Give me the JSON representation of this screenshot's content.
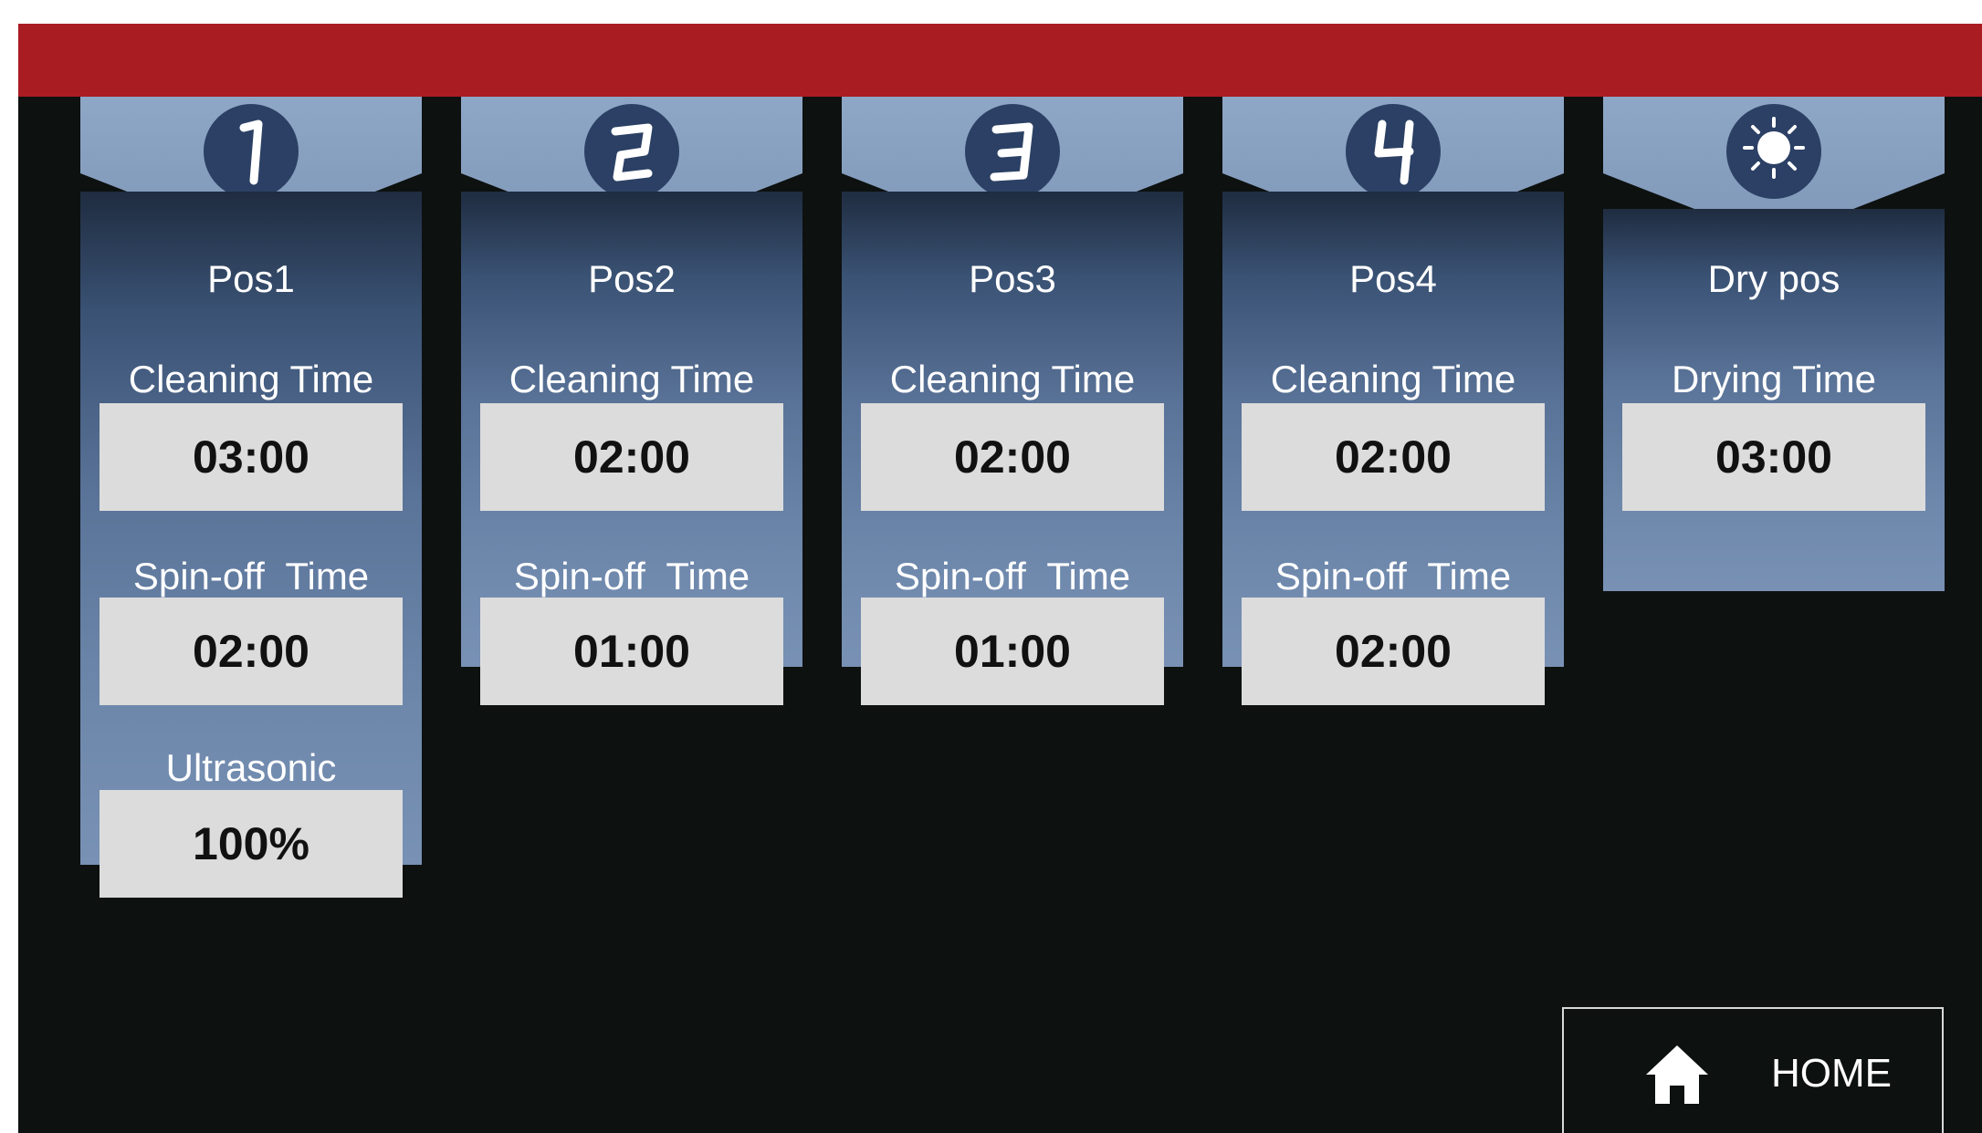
{
  "colors": {
    "top_bar": "#a91c22",
    "background": "#0d1110",
    "tab": "#8fa7c6",
    "badge": "#2b4064",
    "panel_top": "#1f2c40",
    "panel_bottom": "#7891b4",
    "value_box": "#dcdcdc"
  },
  "stations": [
    {
      "badge_icon": "digit-1-icon",
      "badge_text": "1",
      "title": "Pos1",
      "fields": [
        {
          "label": "Cleaning Time",
          "value": "03:00"
        },
        {
          "label": "Spin-off  Time",
          "value": "02:00"
        },
        {
          "label": "Ultrasonic",
          "value": "100%"
        }
      ]
    },
    {
      "badge_icon": "digit-2-icon",
      "badge_text": "2",
      "title": "Pos2",
      "fields": [
        {
          "label": "Cleaning Time",
          "value": "02:00"
        },
        {
          "label": "Spin-off  Time",
          "value": "01:00"
        }
      ]
    },
    {
      "badge_icon": "digit-3-icon",
      "badge_text": "3",
      "title": "Pos3",
      "fields": [
        {
          "label": "Cleaning Time",
          "value": "02:00"
        },
        {
          "label": "Spin-off  Time",
          "value": "01:00"
        }
      ]
    },
    {
      "badge_icon": "digit-4-icon",
      "badge_text": "4",
      "title": "Pos4",
      "fields": [
        {
          "label": "Cleaning Time",
          "value": "02:00"
        },
        {
          "label": "Spin-off  Time",
          "value": "02:00"
        }
      ]
    },
    {
      "badge_icon": "sun-icon",
      "title": "Dry pos",
      "fields": [
        {
          "label": "Drying Time",
          "value": "03:00"
        }
      ]
    }
  ],
  "home": {
    "label": "HOME",
    "icon": "home-icon"
  }
}
